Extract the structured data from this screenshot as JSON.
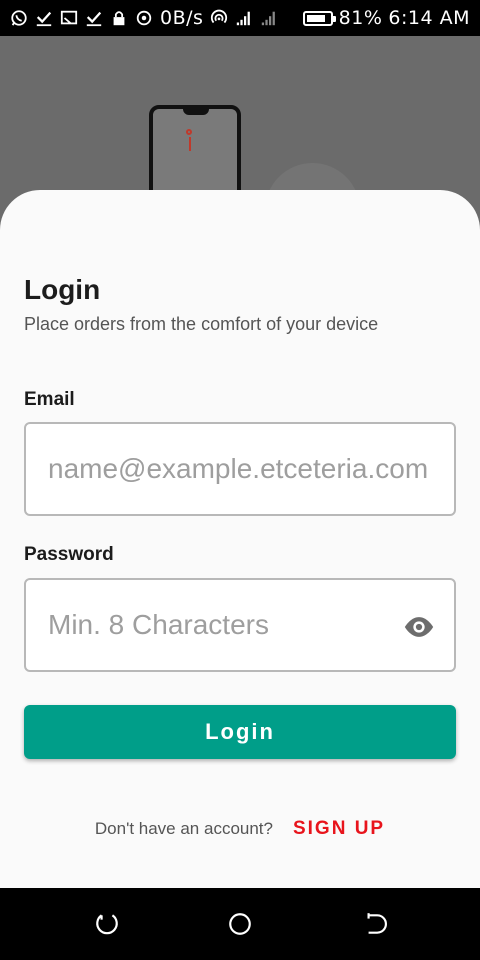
{
  "status_bar": {
    "network_speed": "0B/s",
    "battery_percent": "81%",
    "battery_level": 0.81,
    "time": "6:14 AM",
    "icons": [
      "whatsapp-icon",
      "check-icon",
      "cast-icon",
      "check-icon",
      "lock-icon",
      "data-saver-icon",
      "hotspot-icon",
      "signal-icon",
      "signal-icon",
      "battery-icon"
    ]
  },
  "login": {
    "title": "Login",
    "subtitle": "Place orders from the comfort of your device",
    "email_label": "Email",
    "email_placeholder": "name@example.etceteria.com",
    "email_value": "",
    "password_label": "Password",
    "password_placeholder": "Min. 8 Characters",
    "password_value": "",
    "submit_label": "Login",
    "signup_prompt": "Don't have an account?",
    "signup_link": "SIGN UP"
  },
  "colors": {
    "primary": "#009e89",
    "signup": "#e8141c",
    "sheet": "#fafafa",
    "backdrop": "#6b6b6b"
  },
  "nav_bar": {
    "icons": [
      "recent-apps-icon",
      "home-icon",
      "back-icon"
    ]
  }
}
